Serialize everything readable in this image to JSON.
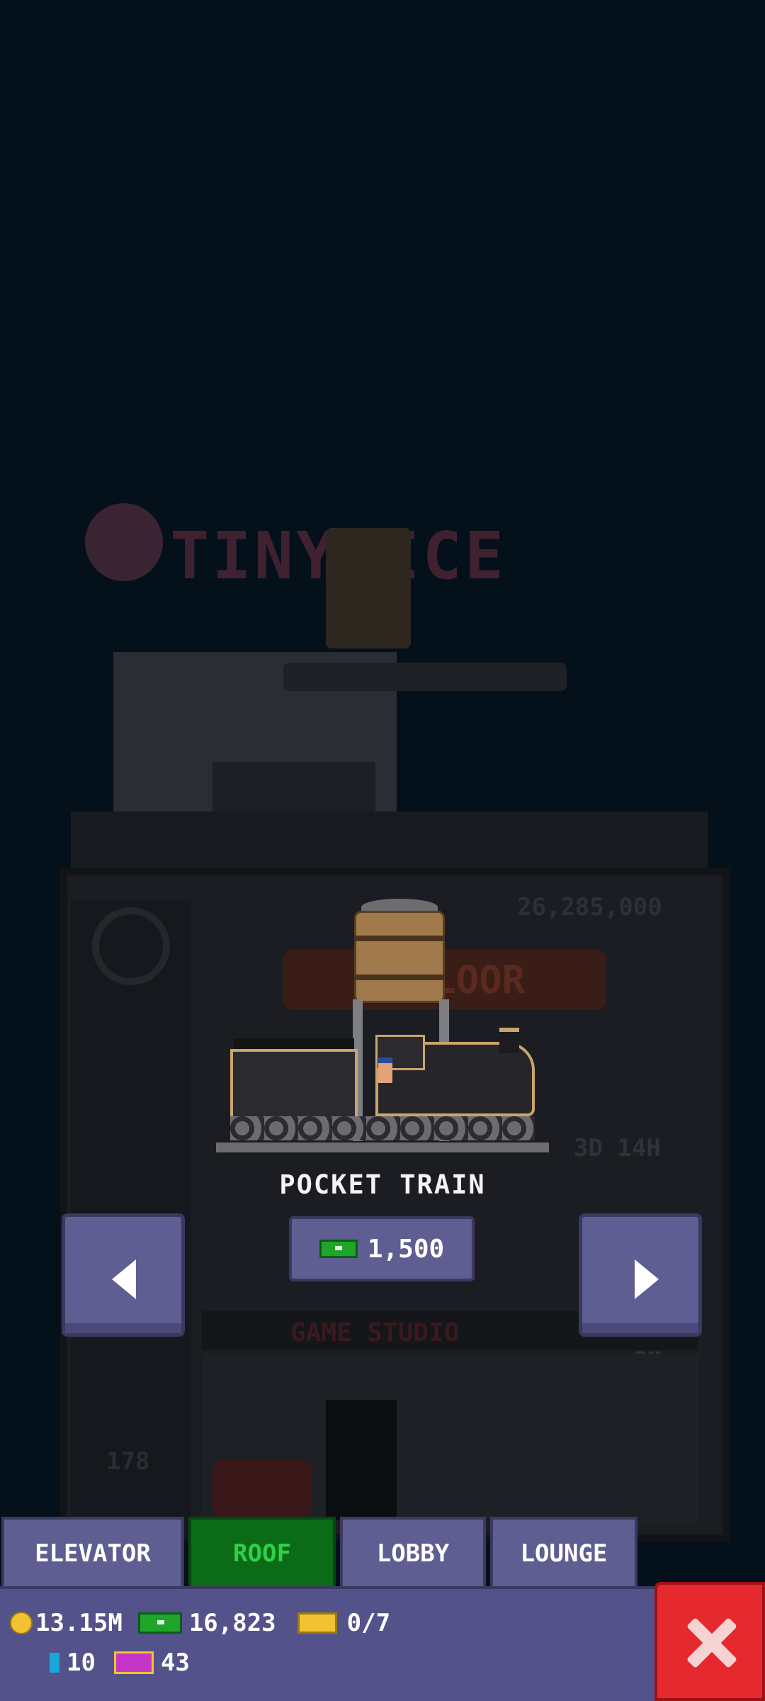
{
  "item": {
    "name": "POCKET TRAIN",
    "price": "1,500"
  },
  "background": {
    "sign_text": "TINY ICE",
    "floor_plate": "L FLOOR",
    "floor_value": "26,285,000",
    "floor_timer": "3D 14H",
    "studio_name": "GAME STUDIO",
    "studio_value": "2M",
    "elevator_number": "178"
  },
  "tabs": [
    {
      "label": "ELEVATOR"
    },
    {
      "label": "ROOF"
    },
    {
      "label": "LOBBY"
    },
    {
      "label": "LOUNGE"
    }
  ],
  "active_tab": "ROOF",
  "status": {
    "coins": "13.15M",
    "bux": "16,823",
    "tickets": "0/7",
    "items": "10",
    "vip": "43"
  },
  "colors": {
    "button": "#5f5e92",
    "active_tab": "#0b6b17",
    "close": "#e5292f",
    "background": "#04101a"
  },
  "icons": [
    "arrow-left-icon",
    "arrow-right-icon",
    "cash-icon",
    "coin-icon",
    "bill-icon",
    "ticket-icon",
    "bux-icon",
    "vip-icon",
    "close-icon"
  ]
}
